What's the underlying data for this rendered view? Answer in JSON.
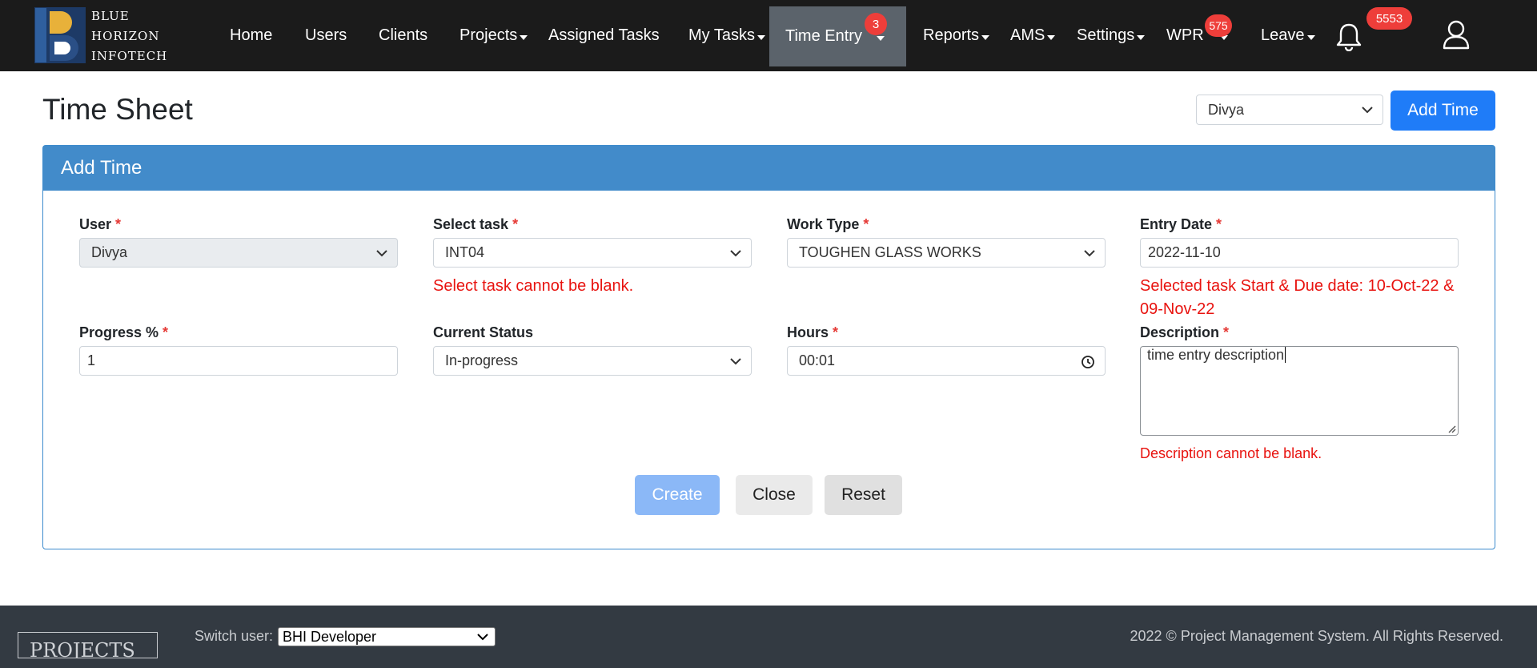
{
  "brand": {
    "line1": "BLUE",
    "line2": "HORIZON",
    "line3": "INFOTECH"
  },
  "nav": {
    "home": "Home",
    "users": "Users",
    "clients": "Clients",
    "projects": "Projects",
    "assigned_tasks": "Assigned Tasks",
    "my_tasks": "My Tasks",
    "time_entry": "Time Entry",
    "time_entry_badge": "3",
    "reports": "Reports",
    "ams": "AMS",
    "settings": "Settings",
    "wpr": "WPR",
    "wpr_badge": "575",
    "leave": "Leave",
    "notifications_badge": "5553"
  },
  "header": {
    "title": "Time Sheet",
    "user_select": "Divya",
    "add_time_button": "Add Time"
  },
  "panel": {
    "title": "Add Time",
    "required_mark": "*",
    "user": {
      "label": "User",
      "value": "Divya"
    },
    "task": {
      "label": "Select task",
      "value": "INT04",
      "error": "Select task cannot be blank."
    },
    "work_type": {
      "label": "Work Type",
      "value": "TOUGHEN GLASS WORKS"
    },
    "entry_date": {
      "label": "Entry Date",
      "value": "2022-11-10",
      "note_line1": "Selected task Start & Due date: 10-Oct-22 &",
      "note_line2": "09-Nov-22"
    },
    "progress": {
      "label": "Progress %",
      "value": "1"
    },
    "status": {
      "label": "Current Status",
      "value": "In-progress"
    },
    "hours": {
      "label": "Hours",
      "value": "00:01"
    },
    "description": {
      "label": "Description",
      "value": "time entry description",
      "error": "Description cannot be blank."
    },
    "buttons": {
      "create": "Create",
      "close": "Close",
      "reset": "Reset"
    }
  },
  "footer": {
    "logo_text": "PROJECTS",
    "switch_label": "Switch user:",
    "switch_value": "BHI Developer",
    "copyright": "2022 © Project Management System. All Rights Reserved."
  },
  "colors": {
    "nav_bg": "#1b1b1b",
    "primary": "#1f7cf8",
    "panel_head": "#428bca",
    "error": "#e8130f",
    "badge": "#ee3e3a"
  }
}
